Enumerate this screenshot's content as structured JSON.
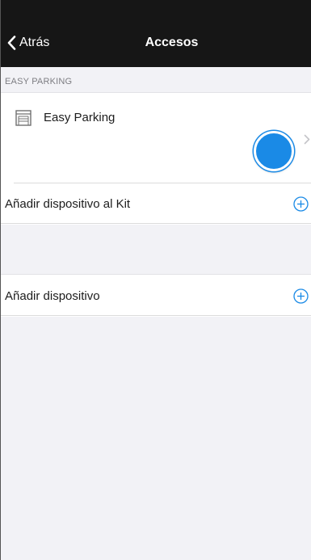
{
  "nav": {
    "back_label": "Atrás",
    "title": "Accesos"
  },
  "section": {
    "header": "EASY PARKING"
  },
  "device": {
    "name": "Easy Parking",
    "icon": "garage-door-icon"
  },
  "actions": {
    "add_to_kit": "Añadir dispositivo al Kit",
    "add_device": "Añadir dispositivo"
  },
  "colors": {
    "accent": "#1a8ae6",
    "topbar": "#161616",
    "background": "#f2f2f6"
  }
}
